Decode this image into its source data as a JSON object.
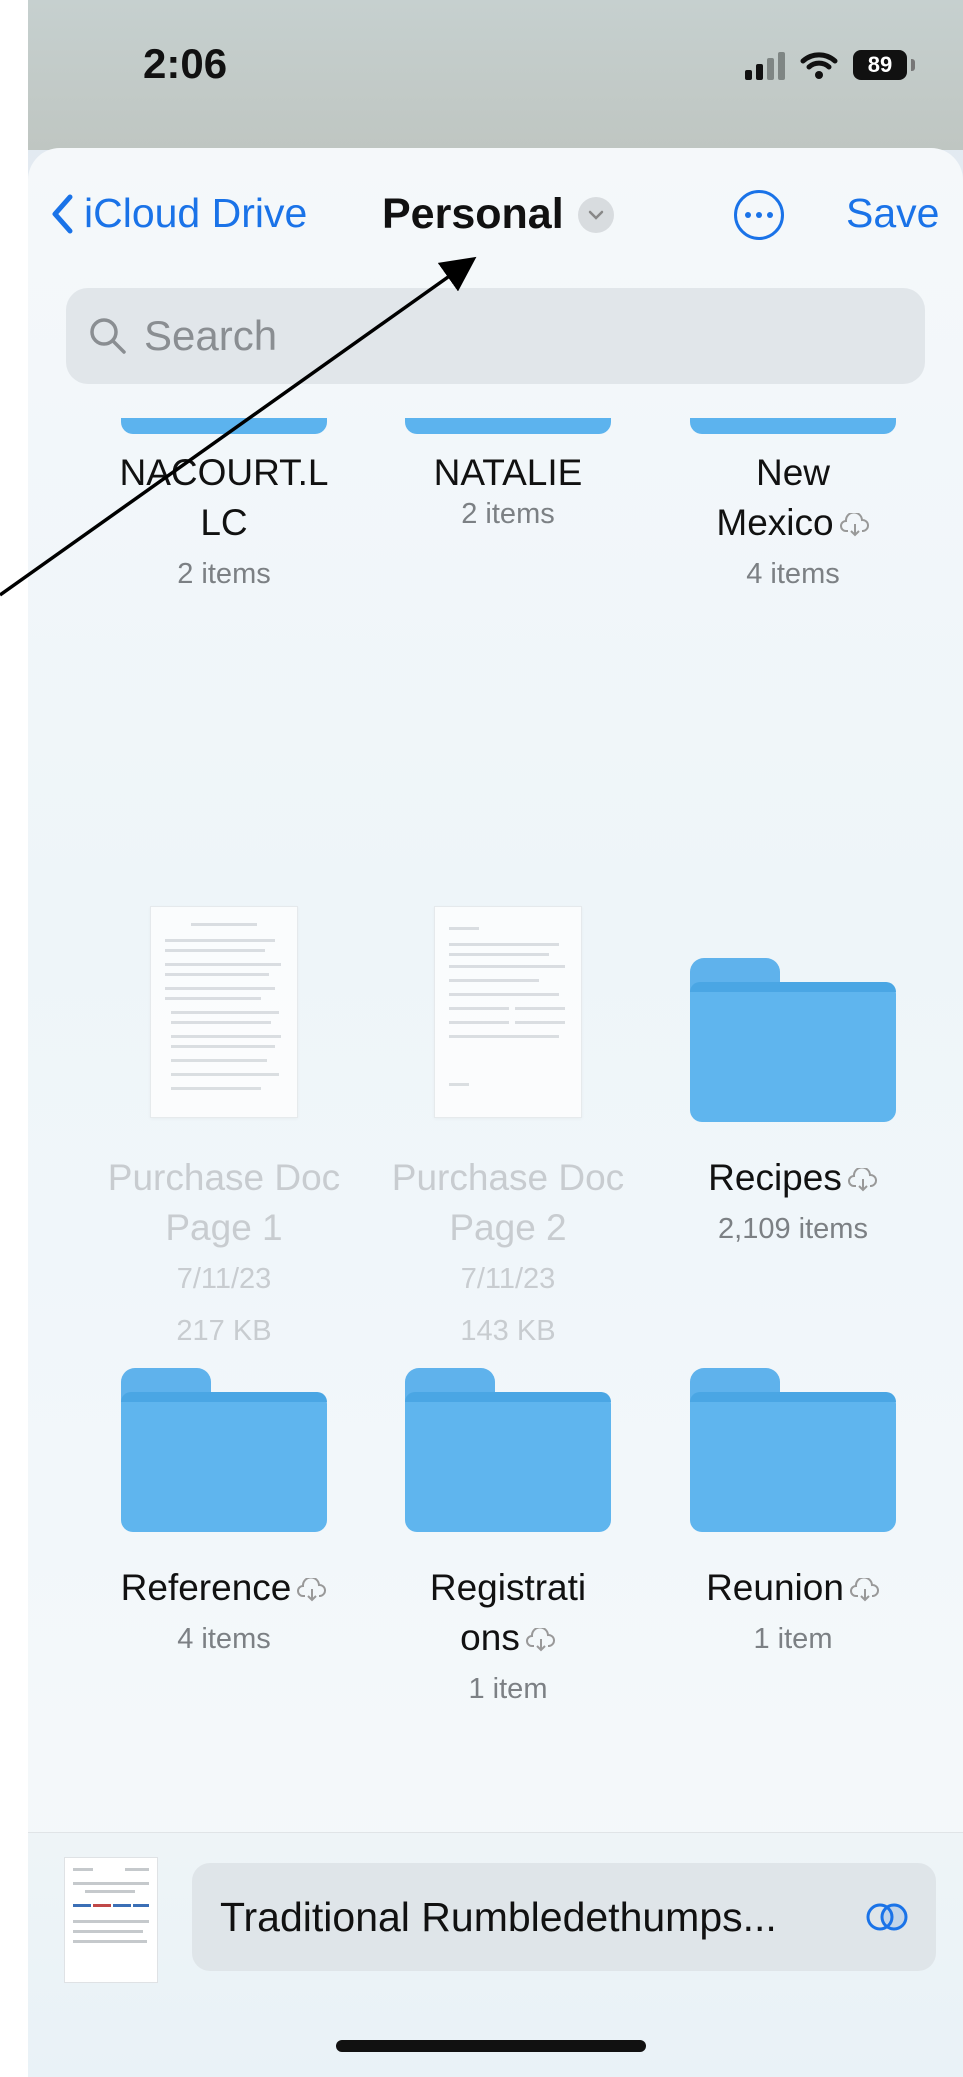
{
  "status_bar": {
    "time": "2:06",
    "battery": "89"
  },
  "nav": {
    "back_label": "iCloud Drive",
    "title": "Personal",
    "save_label": "Save"
  },
  "search": {
    "placeholder": "Search"
  },
  "items_row1": [
    {
      "name": "NACOURT.L\nLC",
      "meta": "2 items",
      "cloud": false
    },
    {
      "name": "NATALIE",
      "meta": "2 items",
      "cloud": false
    },
    {
      "name": "New Mexico",
      "meta": "4 items",
      "cloud": true
    }
  ],
  "items_row2": [
    {
      "name": "Purchase Doc Page 1",
      "date": "7/11/23",
      "size": "217 KB"
    },
    {
      "name": "Purchase Doc Page 2",
      "date": "7/11/23",
      "size": "143 KB"
    },
    {
      "name": "Recipes",
      "meta": "2,109 items",
      "cloud": true
    }
  ],
  "items_row3": [
    {
      "name": "Reference",
      "meta": "4 items",
      "cloud": true
    },
    {
      "name": "Registrations",
      "meta": "1 item",
      "cloud": true
    },
    {
      "name": "Reunion",
      "meta": "1 item",
      "cloud": true
    }
  ],
  "bottom": {
    "filename": "Traditional Rumbledethumps..."
  },
  "colors": {
    "accent": "#1a73e8",
    "folder": "#5fb5ee"
  },
  "icons": [
    "chevron-left-icon",
    "chevron-down-icon",
    "more-icon",
    "search-icon",
    "cloud-download-icon",
    "toggle-icon"
  ]
}
